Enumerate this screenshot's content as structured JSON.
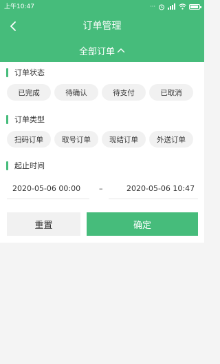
{
  "statusbar": {
    "time": "上午10:47"
  },
  "header": {
    "title": "订单管理",
    "back_icon": "chevron-left-icon"
  },
  "filter": {
    "label": "全部订单",
    "icon": "chevron-up-icon"
  },
  "sections": {
    "status": {
      "title": "订单状态",
      "options": [
        "已完成",
        "待确认",
        "待支付",
        "已取消"
      ]
    },
    "type": {
      "title": "订单类型",
      "options": [
        "扫码订单",
        "取号订单",
        "现结订单",
        "外送订单"
      ]
    },
    "time": {
      "title": "起止时间",
      "start": "2020-05-06 00:00",
      "separator": "–",
      "end": "2020-05-06 10:47"
    }
  },
  "buttons": {
    "reset": "重置",
    "confirm": "确定"
  },
  "colors": {
    "accent": "#46bc7b",
    "background": "#f4f4f4",
    "chip": "#f1f1f1"
  }
}
